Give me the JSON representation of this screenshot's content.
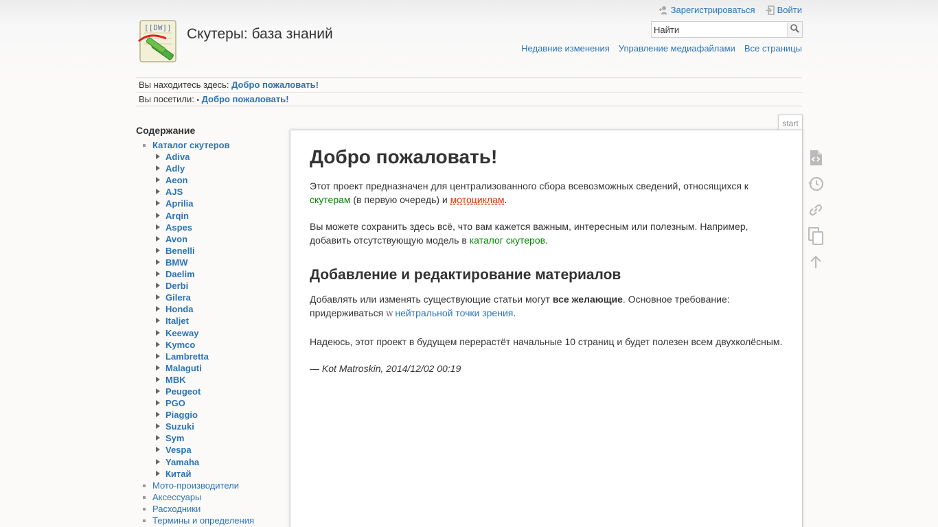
{
  "header": {
    "title": "Скутеры: база знаний",
    "logo_text": "[[DW]]",
    "user_tools": [
      {
        "label": "Зарегистрироваться",
        "icon": "user-add-icon"
      },
      {
        "label": "Войти",
        "icon": "login-icon"
      }
    ],
    "search": {
      "placeholder": "Найти",
      "icon": "search-icon"
    },
    "site_tools": [
      "Недавние изменения",
      "Управление медиафайлами",
      "Все страницы"
    ]
  },
  "breadcrumbs": {
    "location_label": "Вы находитесь здесь:",
    "location_link": "Добро пожаловать!",
    "visited_label": "Вы посетили:",
    "visited_sep": "•",
    "visited_link": "Добро пожаловать!"
  },
  "sidebar": {
    "title": "Содержание",
    "catalog": "Каталог скутеров",
    "brands": [
      "Adiva",
      "Adly",
      "Aeon",
      "AJS",
      "Aprilia",
      "Arqin",
      "Aspes",
      "Avon",
      "Benelli",
      "BMW",
      "Daelim",
      "Derbi",
      "Gilera",
      "Honda",
      "Italjet",
      "Keeway",
      "Kymco",
      "Lambretta",
      "Malaguti",
      "MBK",
      "Peugeot",
      "PGO",
      "Piaggio",
      "Suzuki",
      "Sym",
      "Vespa",
      "Yamaha",
      "Китай"
    ],
    "other": [
      "Мото-производители",
      "Аксессуары",
      "Расходники",
      "Термины и определения"
    ]
  },
  "page": {
    "tab": "start",
    "h1": "Добро пожаловать!",
    "p1_a": "Этот проект предназначен для централизованного сбора всевозможных сведений, относящихся к ",
    "p1_link1": "скутерам",
    "p1_b": " (в первую очередь) и ",
    "p1_link2": "мотоциклам",
    "p1_c": ".",
    "p2_a": "Вы можете сохранить здесь всё, что вам кажется важным, интересным или полезным. Например, добавить отсутствующую модель в ",
    "p2_link": "каталог скутеров",
    "p2_b": ".",
    "h2": "Добавление и редактирование материалов",
    "p3_a": "Добавлять или изменять существующие статьи могут ",
    "p3_bold": "все желающие",
    "p3_b": ". Основное требование: придерживаться ",
    "p3_link": "нейтральной точки зрения",
    "p3_c": ".",
    "p4": "Надеюсь, этот проект в будущем перерастёт начальные 10 страниц и будет полезен всем двухколёсным.",
    "sig_dash": "— ",
    "sig": "Kot Matroskin, 2014/12/02 00:19"
  },
  "page_tools": [
    "show-source-icon",
    "old-revisions-icon",
    "backlinks-icon",
    "copy-icon",
    "back-to-top-icon"
  ],
  "colors": {
    "link": "#2b73b7",
    "existing_link": "#008800",
    "missing_link": "#dd3300"
  }
}
